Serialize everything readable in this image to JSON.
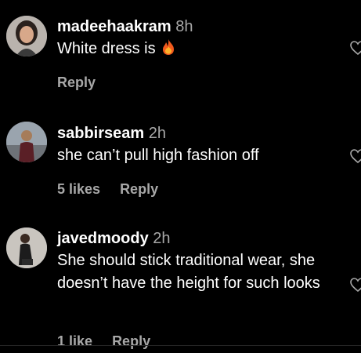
{
  "comments": [
    {
      "username": "madeehaakram",
      "time": "8h",
      "text": "White dress is",
      "emoji_icon": "fire-emoji",
      "likes": "",
      "reply": "Reply"
    },
    {
      "username": "sabbirseam",
      "time": "2h",
      "text": "she can’t pull high fashion off",
      "likes": "5 likes",
      "reply": "Reply"
    },
    {
      "username": "javedmoody",
      "time": "2h",
      "text": "She should stick traditional wear, she doesn’t have the height for such looks",
      "likes": "1 like",
      "reply": "Reply"
    }
  ],
  "colors": {
    "background": "#000000",
    "primary_text": "#ffffff",
    "secondary_text": "#a8a8a8"
  }
}
